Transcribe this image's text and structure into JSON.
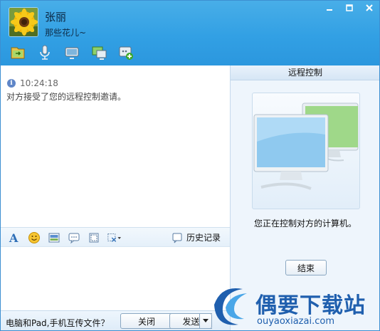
{
  "contact": {
    "name": "张丽",
    "signature": "那些花儿~"
  },
  "window_controls": [
    "minimize-icon",
    "maximize-icon",
    "close-icon"
  ],
  "toolbar": {
    "icons": [
      "file-transfer-icon",
      "voice-call-icon",
      "video-call-icon",
      "remote-desktop-icon",
      "add-app-icon"
    ]
  },
  "chat": {
    "messages": [
      {
        "time": "10:24:18",
        "text": "对方接受了您的远程控制邀请。"
      }
    ]
  },
  "format_bar": {
    "icons": [
      "font-icon",
      "emoji-icon",
      "image-icon",
      "bubble-icon",
      "screen-record-icon",
      "screenshot-icon"
    ],
    "history_label": "历史记录"
  },
  "bottom_bar": {
    "tip": "电脑和Pad,手机互传文件？",
    "close_label": "关闭",
    "send_label": "发送"
  },
  "remote_panel": {
    "title": "远程控制",
    "status": "您正在控制对方的计算机。",
    "end_label": "结束"
  },
  "watermark": {
    "title": "偶要下载站",
    "url": "ouyaoxiazai.com"
  },
  "colors": {
    "header_blue": "#32a0e4",
    "panel_bg": "#eef5fc",
    "watermark_blue": "#1f5fae"
  }
}
